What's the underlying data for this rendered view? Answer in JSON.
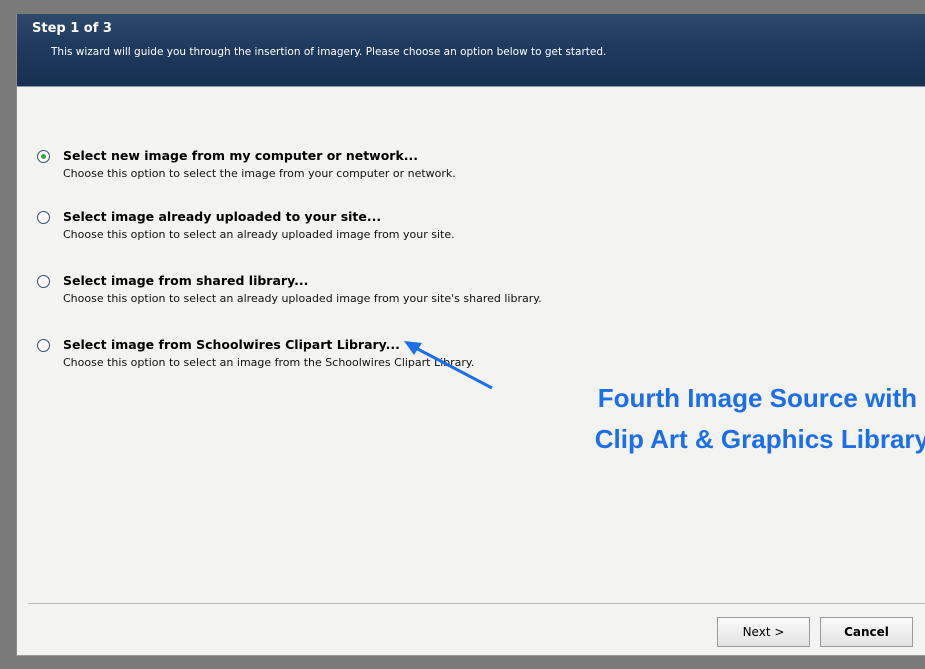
{
  "header": {
    "title": "Step 1 of 3",
    "subtitle": "This wizard will guide you through the insertion of imagery. Please choose an option below to get started."
  },
  "options": [
    {
      "title": "Select new image from my computer or network...",
      "desc": "Choose this option to select the image from your computer or network.",
      "selected": true
    },
    {
      "title": "Select image already uploaded to your site...",
      "desc": "Choose this option to select an already uploaded image from your site.",
      "selected": false
    },
    {
      "title": "Select image from shared library...",
      "desc": "Choose this option to select an already uploaded image from your site's shared library.",
      "selected": false
    },
    {
      "title": "Select image from Schoolwires Clipart Library...",
      "desc": "Choose this option to select an image from the Schoolwires Clipart Library.",
      "selected": false
    }
  ],
  "buttons": {
    "next": "Next >",
    "cancel": "Cancel"
  },
  "annotation": {
    "line1": "Fourth Image Source with",
    "line2": "Clip Art & Graphics Library",
    "color": "#1e6ee8"
  },
  "colors": {
    "header_bg": "#1e3a5e",
    "radio_selected": "#3aa53a"
  }
}
